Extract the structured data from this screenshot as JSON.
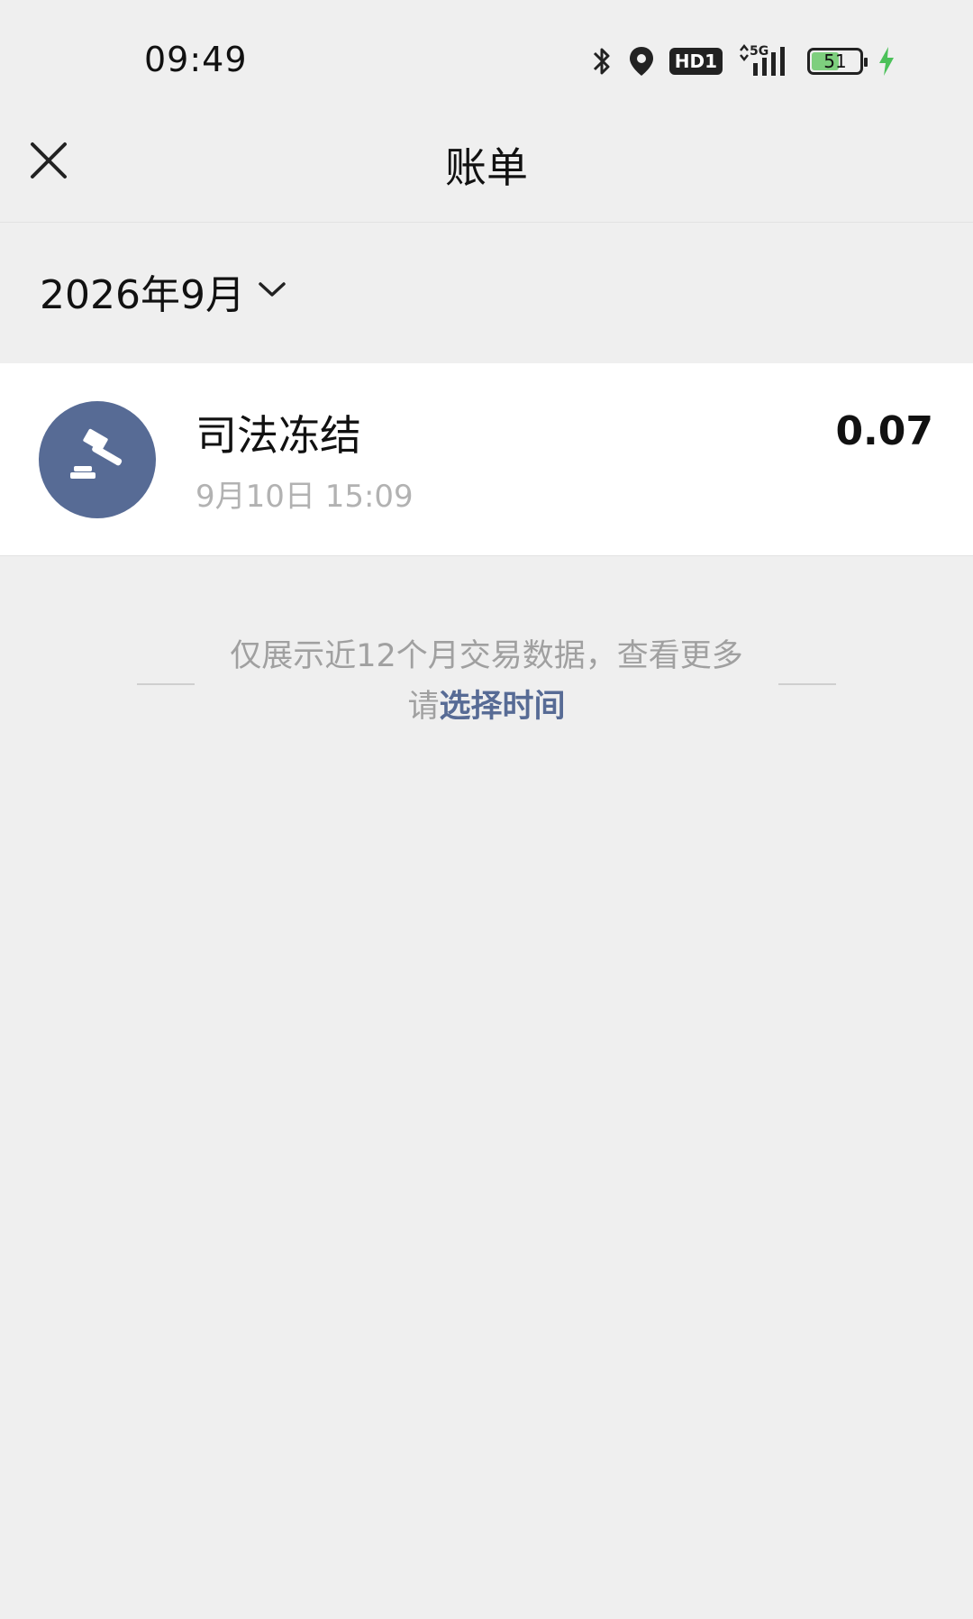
{
  "status_bar": {
    "time": "09:49",
    "icons": [
      "bluetooth-icon",
      "location-icon",
      "hd-icon",
      "5g-signal-icon",
      "battery-icon",
      "charging-icon"
    ],
    "hd_label": "HD1",
    "network_label": "5G",
    "battery_level": "51"
  },
  "nav": {
    "title": "账单",
    "close_icon": "close-icon"
  },
  "month_selector": {
    "label": "2026年9月",
    "icon": "chevron-down-icon"
  },
  "transactions": [
    {
      "title": "司法冻结",
      "time": "9月10日 15:09",
      "amount": "0.07",
      "icon": "gavel-icon",
      "icon_bg": "#576b95"
    }
  ],
  "notice": {
    "text_prefix": "仅展示近12个月交易数据，查看更多请",
    "link_text": "选择时间"
  },
  "colors": {
    "background": "#efefef",
    "link": "#576b95",
    "secondary_text": "#b2b2b2",
    "charging": "#4cc15a",
    "battery_fill": "#7ecf7e"
  }
}
